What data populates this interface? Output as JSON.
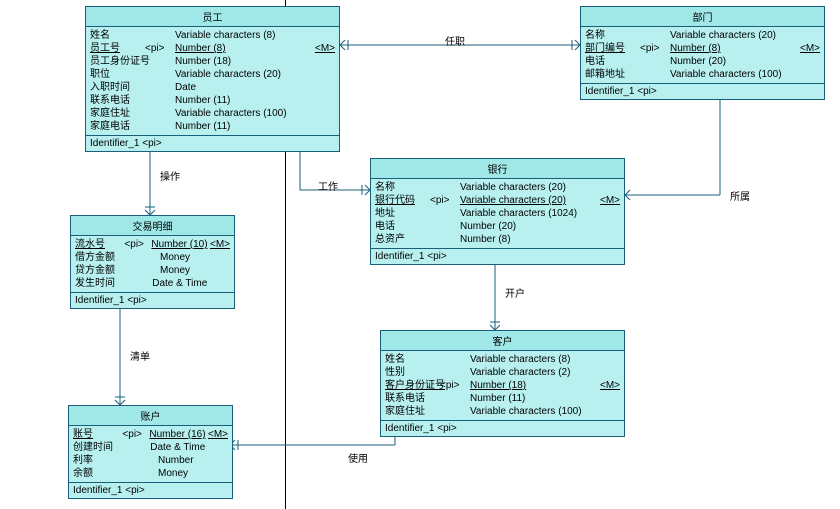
{
  "chart_data": {
    "type": "table",
    "diagram_type": "CDM/ER",
    "entities": [
      {
        "name": "员工",
        "attributes": [
          {
            "name": "姓名",
            "pi": "",
            "type": "Variable characters (8)",
            "m": ""
          },
          {
            "name": "员工号",
            "pi": "<pi>",
            "type": "Number (8)",
            "m": "<M>",
            "underline": true
          },
          {
            "name": "员工身份证号",
            "pi": "",
            "type": "Number (18)",
            "m": ""
          },
          {
            "name": "职位",
            "pi": "",
            "type": "Variable characters (20)",
            "m": ""
          },
          {
            "name": "入职时间",
            "pi": "",
            "type": "Date",
            "m": ""
          },
          {
            "name": "联系电话",
            "pi": "",
            "type": "Number (11)",
            "m": ""
          },
          {
            "name": "家庭住址",
            "pi": "",
            "type": "Variable characters (100)",
            "m": ""
          },
          {
            "name": "家庭电话",
            "pi": "",
            "type": "Number (11)",
            "m": ""
          }
        ],
        "identifier": "Identifier_1 <pi>"
      },
      {
        "name": "部门",
        "attributes": [
          {
            "name": "名称",
            "pi": "",
            "type": "Variable characters (20)",
            "m": ""
          },
          {
            "name": "部门编号",
            "pi": "<pi>",
            "type": "Number (8)",
            "m": "<M>",
            "underline": true
          },
          {
            "name": "电话",
            "pi": "",
            "type": "Number (20)",
            "m": ""
          },
          {
            "name": "邮箱地址",
            "pi": "",
            "type": "Variable characters (100)",
            "m": ""
          }
        ],
        "identifier": "Identifier_1 <pi>"
      },
      {
        "name": "交易明细",
        "attributes": [
          {
            "name": "流水号",
            "pi": "<pi>",
            "type": "Number (10)",
            "m": "<M>",
            "underline": true
          },
          {
            "name": "借方金额",
            "pi": "",
            "type": "Money",
            "m": ""
          },
          {
            "name": "贷方金额",
            "pi": "",
            "type": "Money",
            "m": ""
          },
          {
            "name": "发生时间",
            "pi": "",
            "type": "Date & Time",
            "m": ""
          }
        ],
        "identifier": "Identifier_1 <pi>"
      },
      {
        "name": "银行",
        "attributes": [
          {
            "name": "名称",
            "pi": "",
            "type": "Variable characters (20)",
            "m": ""
          },
          {
            "name": "银行代码",
            "pi": "<pi>",
            "type": "Variable characters (20)",
            "m": "<M>",
            "underline": true
          },
          {
            "name": "地址",
            "pi": "",
            "type": "Variable characters (1024)",
            "m": ""
          },
          {
            "name": "电话",
            "pi": "",
            "type": "Number (20)",
            "m": ""
          },
          {
            "name": "总资产",
            "pi": "",
            "type": "Number (8)",
            "m": ""
          }
        ],
        "identifier": "Identifier_1 <pi>"
      },
      {
        "name": "账户",
        "attributes": [
          {
            "name": "账号",
            "pi": "<pi>",
            "type": "Number (16)",
            "m": "<M>",
            "underline": true
          },
          {
            "name": "创建时间",
            "pi": "",
            "type": "Date & Time",
            "m": ""
          },
          {
            "name": "利率",
            "pi": "",
            "type": "Number",
            "m": ""
          },
          {
            "name": "余额",
            "pi": "",
            "type": "Money",
            "m": ""
          }
        ],
        "identifier": "Identifier_1 <pi>"
      },
      {
        "name": "客户",
        "attributes": [
          {
            "name": "姓名",
            "pi": "",
            "type": "Variable characters (8)",
            "m": ""
          },
          {
            "name": "性别",
            "pi": "",
            "type": "Variable characters (2)",
            "m": ""
          },
          {
            "name": "客户身份证号",
            "pi": "<pi>",
            "type": "Number (18)",
            "m": "<M>",
            "underline": true
          },
          {
            "name": "联系电话",
            "pi": "",
            "type": "Number (11)",
            "m": ""
          },
          {
            "name": "家庭住址",
            "pi": "",
            "type": "Variable characters (100)",
            "m": ""
          }
        ],
        "identifier": "Identifier_1 <pi>"
      }
    ],
    "relationships": [
      {
        "name": "任职",
        "between": [
          "员工",
          "部门"
        ]
      },
      {
        "name": "操作",
        "between": [
          "员工",
          "交易明细"
        ]
      },
      {
        "name": "工作",
        "between": [
          "员工",
          "银行"
        ]
      },
      {
        "name": "所属",
        "between": [
          "部门",
          "银行"
        ]
      },
      {
        "name": "开户",
        "between": [
          "银行",
          "客户"
        ]
      },
      {
        "name": "清单",
        "between": [
          "交易明细",
          "账户"
        ]
      },
      {
        "name": "使用",
        "between": [
          "账户",
          "客户"
        ]
      }
    ]
  },
  "labels": {
    "renzhi": "任职",
    "caozuo": "操作",
    "gongzuo": "工作",
    "suoshu": "所属",
    "kaihu": "开户",
    "qingdan": "清单",
    "shiyong": "使用"
  }
}
